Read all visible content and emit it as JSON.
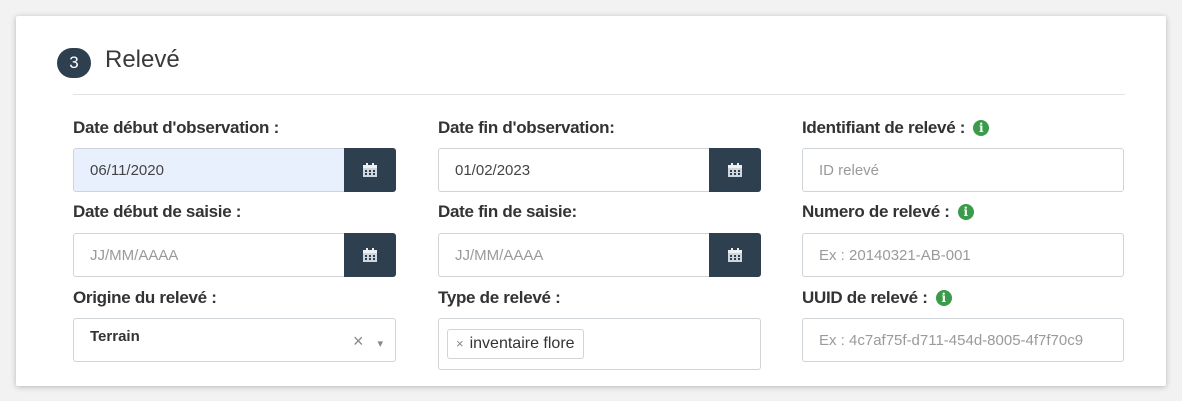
{
  "section": {
    "number": "3",
    "title": "Relevé"
  },
  "fields": {
    "date_debut_obs": {
      "label": "Date début d'observation :",
      "value": "06/11/2020"
    },
    "date_fin_obs": {
      "label": "Date fin d'observation:",
      "value": "01/02/2023"
    },
    "identifiant": {
      "label": "Identifiant de relevé :",
      "placeholder": "ID relevé"
    },
    "date_debut_saisie": {
      "label": "Date début de saisie :",
      "placeholder": "JJ/MM/AAAA"
    },
    "date_fin_saisie": {
      "label": "Date fin de saisie:",
      "placeholder": "JJ/MM/AAAA"
    },
    "numero": {
      "label": "Numero de relevé :",
      "placeholder": "Ex : 20140321-AB-001"
    },
    "origine": {
      "label": "Origine du relevé :",
      "value": "Terrain",
      "clear": "×",
      "caret": "▾"
    },
    "type": {
      "label": "Type de relevé :",
      "chip_remove": "×",
      "chip": "inventaire flore"
    },
    "uuid": {
      "label": "UUID de relevé :",
      "placeholder": "Ex : 4c7af75f-d711-454d-8005-4f7f70c9"
    }
  },
  "icons": {
    "info": "i",
    "calendar": "calendar-icon"
  },
  "colors": {
    "dark_button": "#2e3f4f",
    "info_green": "#3a9b4a",
    "autofill_blue": "#e8f0fe"
  }
}
